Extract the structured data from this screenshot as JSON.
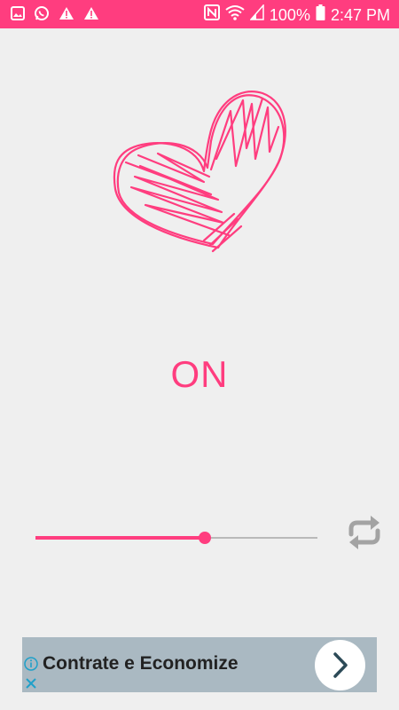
{
  "status_bar": {
    "battery": "100%",
    "time": "2:47 PM",
    "left_icons": [
      "gallery-icon",
      "whatsapp-icon",
      "warning-icon",
      "warning-icon"
    ],
    "right_icons": [
      "nfc-icon",
      "wifi-icon",
      "signal-icon",
      "battery-icon"
    ]
  },
  "main": {
    "heart_icon": "heart-scribble-icon",
    "state": "ON",
    "slider_value": 0.6,
    "repeat_icon": "repeat-icon"
  },
  "ad": {
    "text": "Contrate e Economize",
    "info_icon": "info-icon",
    "close_icon": "close-icon",
    "go_icon": "chevron-right-icon"
  },
  "colors": {
    "accent": "#ff3d7f",
    "background": "#efefef",
    "ad_background": "#aab9c2"
  }
}
